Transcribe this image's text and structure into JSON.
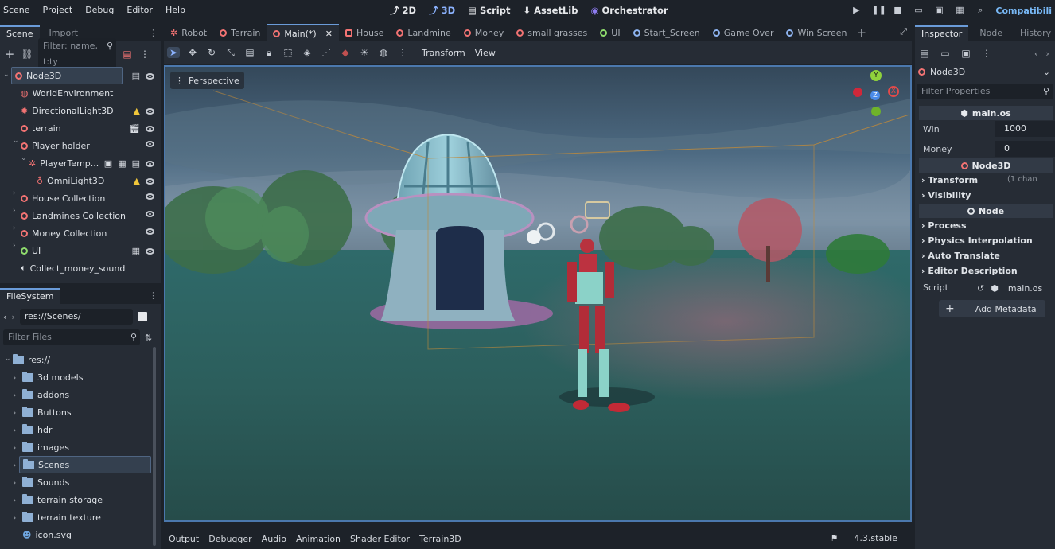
{
  "menu": [
    "Scene",
    "Project",
    "Debug",
    "Editor",
    "Help"
  ],
  "workspaces": [
    {
      "label": "2D",
      "icon": "2d-icon"
    },
    {
      "label": "3D",
      "icon": "3d-icon"
    },
    {
      "label": "Script",
      "icon": "script-icon"
    },
    {
      "label": "AssetLib",
      "icon": "assetlib-icon"
    },
    {
      "label": "Orchestrator",
      "icon": "orchestrator-icon"
    }
  ],
  "renderer_label": "Compatibili",
  "scene_dock": {
    "tabs": [
      "Scene",
      "Import"
    ],
    "filter_placeholder": "Filter: name, t:ty",
    "nodes": [
      {
        "label": "Node3D",
        "icon": "node3d-icon",
        "depth": 0
      },
      {
        "label": "WorldEnvironment",
        "icon": "world-environment-icon",
        "depth": 1
      },
      {
        "label": "DirectionalLight3D",
        "icon": "directional-light-icon",
        "depth": 1
      },
      {
        "label": "terrain",
        "icon": "node3d-icon",
        "depth": 1
      },
      {
        "label": "Player holder",
        "icon": "node3d-icon",
        "depth": 1
      },
      {
        "label": "PlayerTemp...",
        "icon": "skeleton-icon",
        "depth": 2
      },
      {
        "label": "OmniLight3D",
        "icon": "omni-light-icon",
        "depth": 3
      },
      {
        "label": "House Collection",
        "icon": "node3d-icon",
        "depth": 1
      },
      {
        "label": "Landmines Collection",
        "icon": "node3d-icon",
        "depth": 1
      },
      {
        "label": "Money Collection",
        "icon": "node3d-icon",
        "depth": 1
      },
      {
        "label": "UI",
        "icon": "control-icon",
        "depth": 1
      },
      {
        "label": "Collect_money_sound",
        "icon": "audio-icon",
        "depth": 1
      }
    ]
  },
  "filesystem": {
    "tab": "FileSystem",
    "path": "res://Scenes/",
    "filter_placeholder": "Filter Files",
    "root": "res://",
    "items": [
      "3d models",
      "addons",
      "Buttons",
      "hdr",
      "images",
      "Scenes",
      "Sounds",
      "terrain storage",
      "terrain texture",
      "icon.svg"
    ]
  },
  "scene_tabs": [
    {
      "label": "Robot",
      "icon": "skeleton-icon"
    },
    {
      "label": "Terrain",
      "icon": "node3d-icon"
    },
    {
      "label": "Main(*)",
      "icon": "node3d-icon"
    },
    {
      "label": "House",
      "icon": "mesh-icon"
    },
    {
      "label": "Landmine",
      "icon": "node3d-icon"
    },
    {
      "label": "Money",
      "icon": "node3d-icon"
    },
    {
      "label": "small grasses",
      "icon": "node3d-icon"
    },
    {
      "label": "UI",
      "icon": "control-icon"
    },
    {
      "label": "Start_Screen",
      "icon": "control-icon"
    },
    {
      "label": "Game Over",
      "icon": "control-icon"
    },
    {
      "label": "Win Screen",
      "icon": "control-icon"
    }
  ],
  "viewport": {
    "menus": [
      "Transform",
      "View"
    ],
    "perspective": "Perspective",
    "gizmo": {
      "y": "Y",
      "z": "Z",
      "x": "X"
    }
  },
  "inspector": {
    "tabs": [
      "Inspector",
      "Node",
      "History"
    ],
    "node": "Node3D",
    "filter_placeholder": "Filter Properties",
    "script_section": "main.os",
    "props": [
      {
        "label": "Win",
        "value": "1000"
      },
      {
        "label": "Money",
        "value": "0"
      }
    ],
    "node3d_section": "Node3D",
    "node3d_cats": [
      {
        "label": "Transform",
        "note": "(1 chan"
      },
      {
        "label": "Visibility",
        "note": ""
      }
    ],
    "node_section": "Node",
    "node_cats": [
      "Process",
      "Physics Interpolation",
      "Auto Translate",
      "Editor Description"
    ],
    "script_label": "Script",
    "script_value": "main.os",
    "add_metadata": "Add Metadata"
  },
  "bottom_tabs": [
    "Output",
    "Debugger",
    "Audio",
    "Animation",
    "Shader Editor",
    "Terrain3D"
  ],
  "version": "4.3.stable",
  "colors": {
    "accent": "#6a9bd8",
    "node3d": "#f27373",
    "control": "#8fdc6d",
    "folder": "#8fb0d4"
  }
}
